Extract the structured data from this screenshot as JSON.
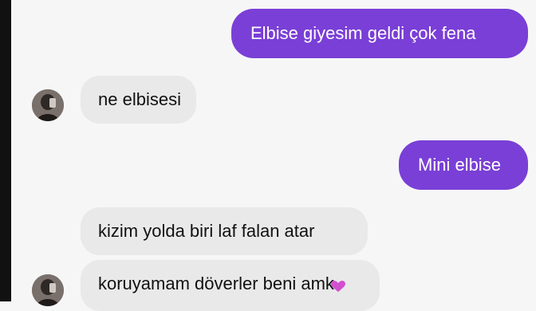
{
  "chat": {
    "messages": [
      {
        "sender": "self",
        "text": "Elbise giyesim geldi çok fena"
      },
      {
        "sender": "other",
        "text": "ne elbisesi"
      },
      {
        "sender": "self",
        "text": "Mini elbise"
      },
      {
        "sender": "other",
        "text": "kizim yolda biri laf falan atar"
      },
      {
        "sender": "other",
        "text": "koruyamam döverler beni amk"
      }
    ]
  },
  "reaction": {
    "icon": "heart-icon",
    "color": "#d24fd0"
  },
  "colors": {
    "outgoing_bubble": "#7a3fd6",
    "incoming_bubble": "#e9e9e9",
    "background": "#f6f6f6"
  },
  "icons": {
    "avatar": "avatar-icon"
  }
}
